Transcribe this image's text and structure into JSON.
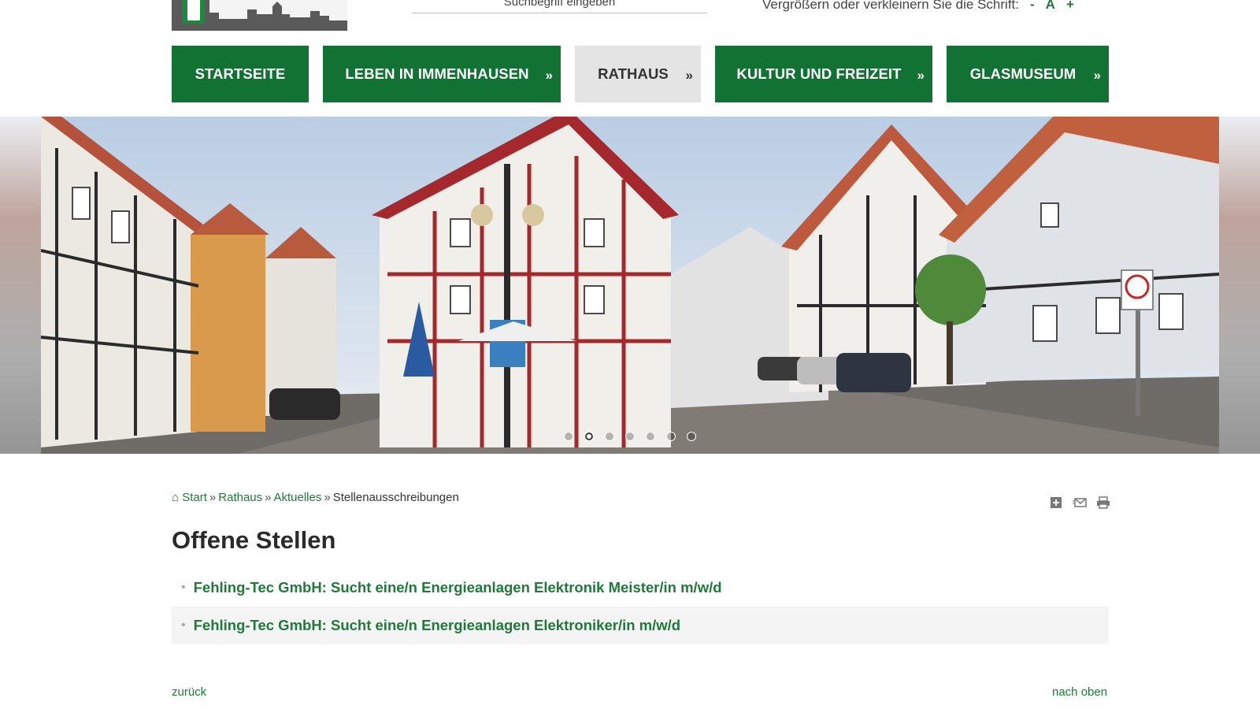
{
  "header": {
    "search_placeholder": "Suchbegriff eingeben",
    "fontsize_label": "Vergrößern oder verkleinern Sie die Schrift:",
    "fontsize_smaller": "-",
    "fontsize_reset": "A",
    "fontsize_larger": "+"
  },
  "nav": {
    "items": [
      {
        "label": "STARTSEITE",
        "arrow": ""
      },
      {
        "label": "LEBEN IN IMMENHAUSEN",
        "arrow": "»"
      },
      {
        "label": "RATHAUS",
        "arrow": "»"
      },
      {
        "label": "KULTUR UND FREIZEIT",
        "arrow": "»"
      },
      {
        "label": "GLASMUSEUM",
        "arrow": "»"
      }
    ]
  },
  "slider": {
    "slide_count": 7,
    "active_index": 1
  },
  "breadcrumb": {
    "home_icon": "⌂",
    "home": "Start",
    "sep": "»",
    "level1": "Rathaus",
    "level2": "Aktuelles",
    "current": "Stellenausschreibungen"
  },
  "page": {
    "title": "Offene Stellen",
    "jobs": [
      "Fehling-Tec GmbH: Sucht eine/n Energieanlagen Elektronik Meister/in m/w/d",
      "Fehling-Tec GmbH: Sucht eine/n Energieanlagen Elektroniker/in m/w/d"
    ]
  },
  "footer": {
    "back": "zurück",
    "top": "nach oben"
  },
  "colors": {
    "brand_green": "#127233",
    "link_green": "#1f7a3a",
    "nav_grey": "#e4e4e4"
  },
  "icons": [
    "home-icon",
    "bookmark-icon",
    "email-icon",
    "print-icon"
  ]
}
